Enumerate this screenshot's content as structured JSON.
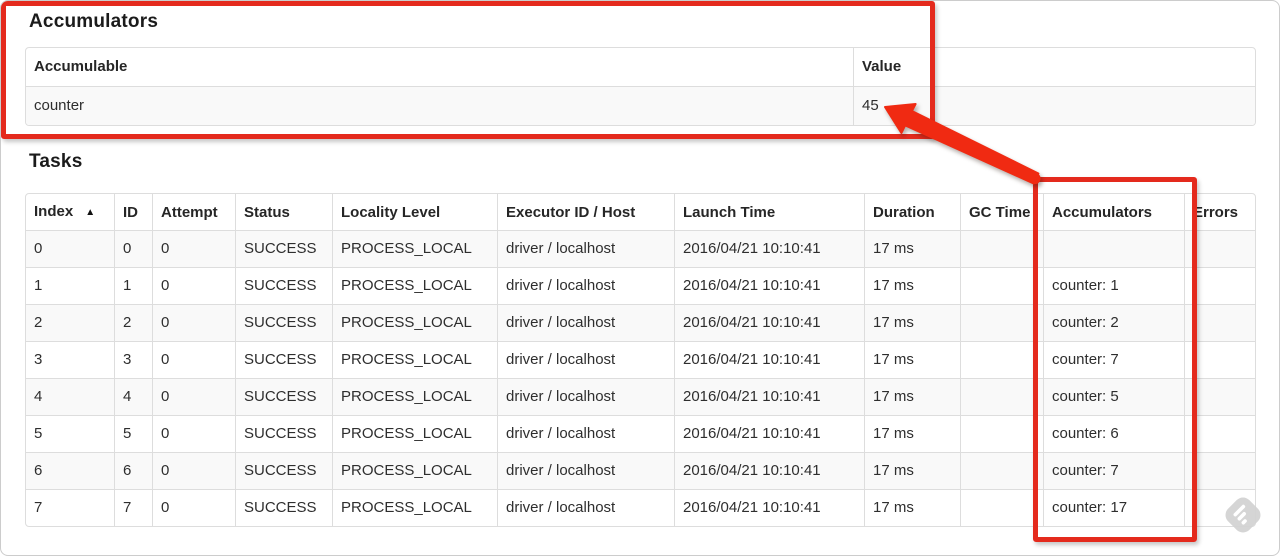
{
  "page": {
    "accumulators_heading": "Accumulators",
    "tasks_heading": "Tasks"
  },
  "accumulators_table": {
    "columns": [
      "Accumulable",
      "Value"
    ],
    "rows": [
      [
        "counter",
        "45"
      ]
    ]
  },
  "tasks_table": {
    "columns": [
      "Index",
      "ID",
      "Attempt",
      "Status",
      "Locality Level",
      "Executor ID / Host",
      "Launch Time",
      "Duration",
      "GC Time",
      "Accumulators",
      "Errors"
    ],
    "sort_column": "Index",
    "sort_indicator": "▲",
    "rows": [
      [
        "0",
        "0",
        "0",
        "SUCCESS",
        "PROCESS_LOCAL",
        "driver / localhost",
        "2016/04/21 10:10:41",
        "17 ms",
        "",
        "",
        ""
      ],
      [
        "1",
        "1",
        "0",
        "SUCCESS",
        "PROCESS_LOCAL",
        "driver / localhost",
        "2016/04/21 10:10:41",
        "17 ms",
        "",
        "counter: 1",
        ""
      ],
      [
        "2",
        "2",
        "0",
        "SUCCESS",
        "PROCESS_LOCAL",
        "driver / localhost",
        "2016/04/21 10:10:41",
        "17 ms",
        "",
        "counter: 2",
        ""
      ],
      [
        "3",
        "3",
        "0",
        "SUCCESS",
        "PROCESS_LOCAL",
        "driver / localhost",
        "2016/04/21 10:10:41",
        "17 ms",
        "",
        "counter: 7",
        ""
      ],
      [
        "4",
        "4",
        "0",
        "SUCCESS",
        "PROCESS_LOCAL",
        "driver / localhost",
        "2016/04/21 10:10:41",
        "17 ms",
        "",
        "counter: 5",
        ""
      ],
      [
        "5",
        "5",
        "0",
        "SUCCESS",
        "PROCESS_LOCAL",
        "driver / localhost",
        "2016/04/21 10:10:41",
        "17 ms",
        "",
        "counter: 6",
        ""
      ],
      [
        "6",
        "6",
        "0",
        "SUCCESS",
        "PROCESS_LOCAL",
        "driver / localhost",
        "2016/04/21 10:10:41",
        "17 ms",
        "",
        "counter: 7",
        ""
      ],
      [
        "7",
        "7",
        "0",
        "SUCCESS",
        "PROCESS_LOCAL",
        "driver / localhost",
        "2016/04/21 10:10:41",
        "17 ms",
        "",
        "counter: 17",
        ""
      ]
    ]
  },
  "annotations": {
    "highlight_color": "#e42a1d",
    "arrow_color": "#f02a12",
    "sort_icon": "ascending-triangle",
    "watermark_icon": "feedly-badge-icon"
  },
  "colors": {
    "table_border": "#dddddd",
    "row_stripe": "#f9f9f9",
    "text": "#2e2e2e"
  }
}
